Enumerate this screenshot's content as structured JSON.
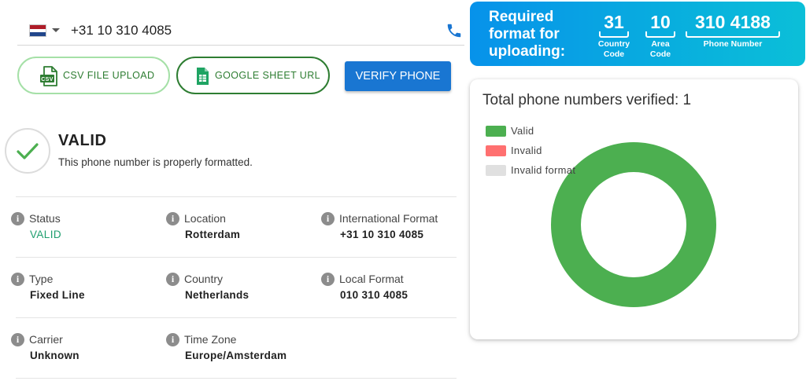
{
  "phone_input": {
    "country": "Netherlands",
    "value": "+31 10 310 4085"
  },
  "buttons": {
    "csv_upload": "CSV FILE UPLOAD",
    "google_sheet": "GOOGLE SHEET URL",
    "verify": "VERIFY PHONE"
  },
  "result": {
    "title": "VALID",
    "message": "This phone number is properly formatted."
  },
  "details": [
    {
      "label": "Status",
      "value": "VALID"
    },
    {
      "label": "Location",
      "value": "Rotterdam"
    },
    {
      "label": "International Format",
      "value": "+31 10 310 4085"
    },
    {
      "label": "Type",
      "value": "Fixed Line"
    },
    {
      "label": "Country",
      "value": "Netherlands"
    },
    {
      "label": "Local Format",
      "value": "010 310 4085"
    },
    {
      "label": "Carrier",
      "value": "Unknown"
    },
    {
      "label": "Time Zone",
      "value": "Europe/Amsterdam"
    }
  ],
  "banner": {
    "title": "Required format for uploading:",
    "parts": [
      {
        "number": "31",
        "label": "Country Code"
      },
      {
        "number": "10",
        "label": "Area Code"
      },
      {
        "number": "310 4188",
        "label": "Phone Number"
      }
    ]
  },
  "chart_data": {
    "type": "pie",
    "title": "Total phone numbers verified: 1",
    "legend_position": "top-left",
    "categories": [
      "Valid",
      "Invalid",
      "Invalid format"
    ],
    "values": [
      1,
      0,
      0
    ],
    "colors": [
      "#4caf50",
      "#ff7070",
      "#e0e0e0"
    ]
  },
  "colors": {
    "accent": "#1976d2",
    "success": "#4caf50",
    "status_text": "#1e9e6e"
  }
}
